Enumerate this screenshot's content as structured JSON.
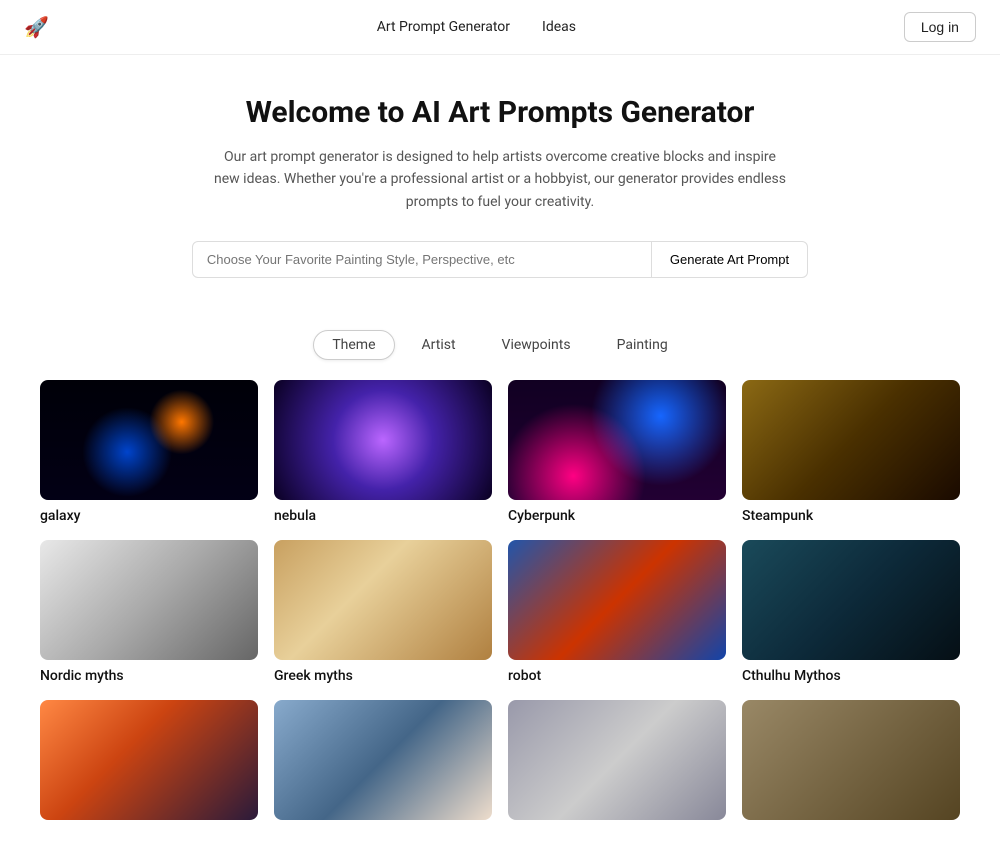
{
  "nav": {
    "logo_icon": "🚀",
    "links": [
      {
        "label": "Art Prompt Generator",
        "id": "art-prompt-generator"
      },
      {
        "label": "Ideas",
        "id": "ideas"
      }
    ],
    "login_label": "Log in"
  },
  "hero": {
    "title": "Welcome to AI Art Prompts Generator",
    "description": "Our art prompt generator is designed to help artists overcome creative blocks and inspire new ideas. Whether you're a professional artist or a hobbyist, our generator provides endless prompts to fuel your creativity.",
    "search_placeholder": "Choose Your Favorite Painting Style, Perspective, etc",
    "search_button": "Generate Art Prompt"
  },
  "tabs": [
    {
      "label": "Theme",
      "active": true
    },
    {
      "label": "Artist",
      "active": false
    },
    {
      "label": "Viewpoints",
      "active": false
    },
    {
      "label": "Painting",
      "active": false
    }
  ],
  "gallery": [
    {
      "label": "galaxy",
      "img_class": "img-galaxy-overlay"
    },
    {
      "label": "nebula",
      "img_class": "img-nebula-overlay"
    },
    {
      "label": "Cyberpunk",
      "img_class": "img-cyber-overlay"
    },
    {
      "label": "Steampunk",
      "img_class": "img-steampunk"
    },
    {
      "label": "Nordic myths",
      "img_class": "img-nordic"
    },
    {
      "label": "Greek myths",
      "img_class": "img-greek"
    },
    {
      "label": "robot",
      "img_class": "img-robot"
    },
    {
      "label": "Cthulhu Mythos",
      "img_class": "img-cthulhu"
    },
    {
      "label": "",
      "img_class": "img-scifi-city"
    },
    {
      "label": "",
      "img_class": "img-char"
    },
    {
      "label": "",
      "img_class": "img-road"
    },
    {
      "label": "",
      "img_class": "img-ruins"
    }
  ]
}
